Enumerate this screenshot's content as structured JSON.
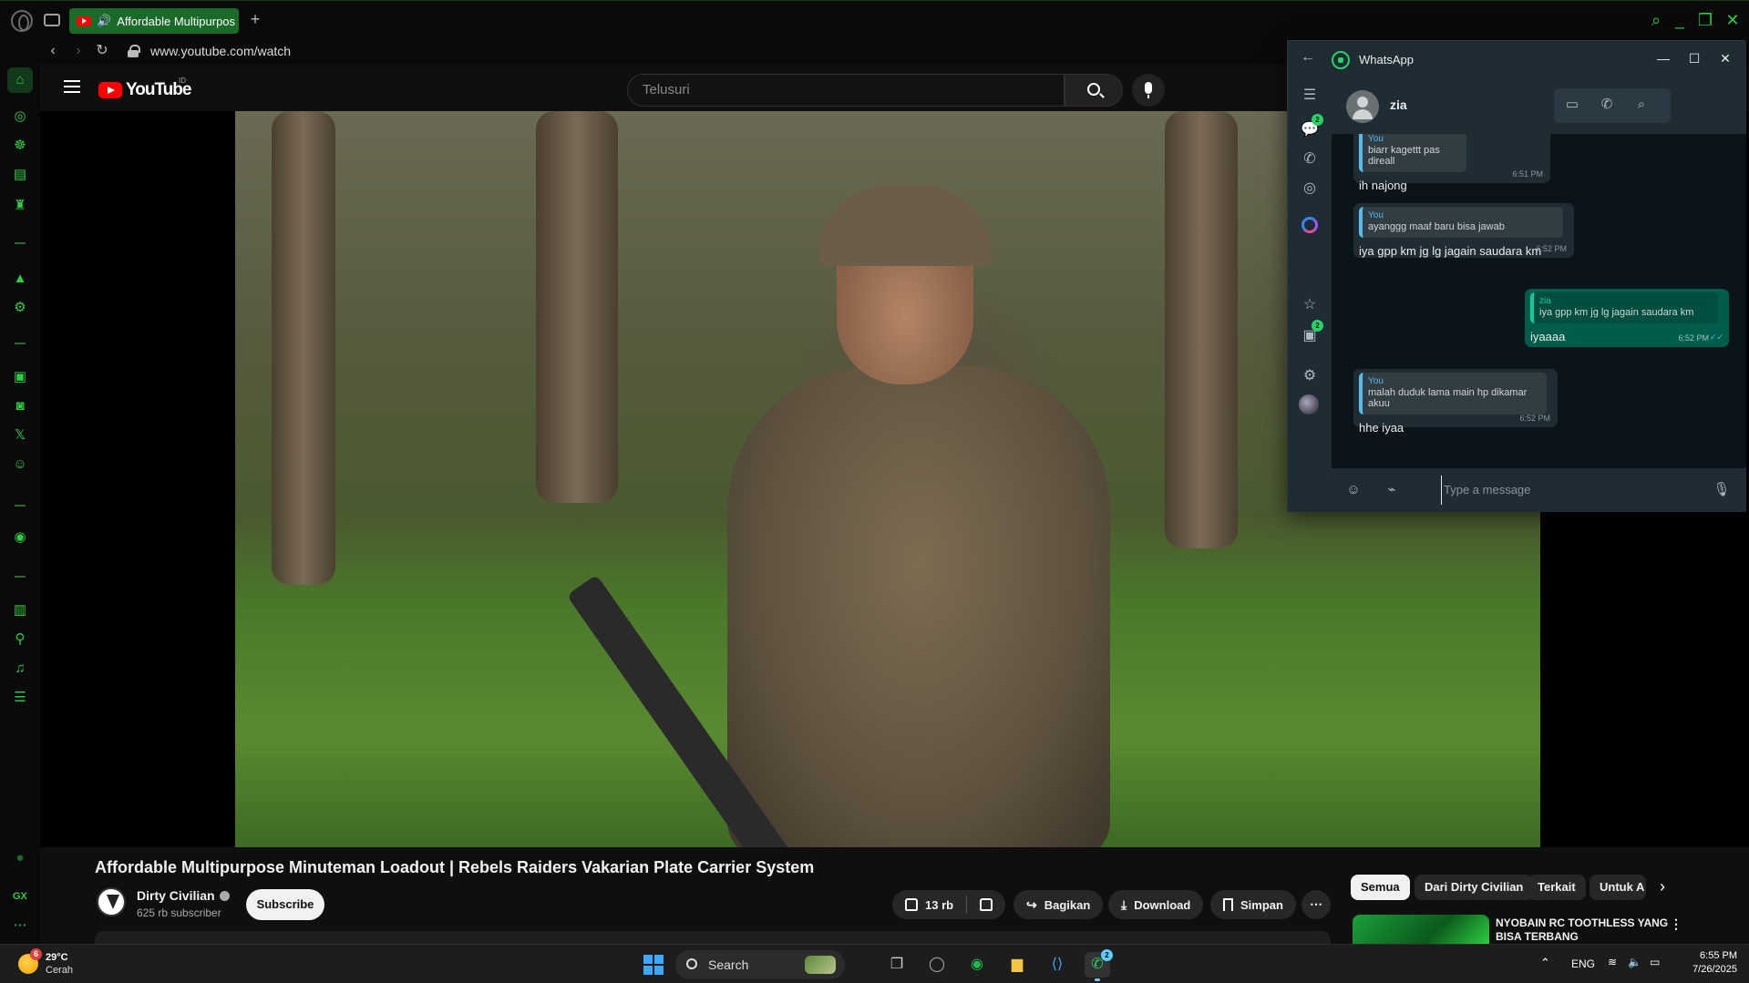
{
  "browser": {
    "tab_title": "Affordable Multipurpos",
    "url": "www.youtube.com/watch",
    "accent": "#2ecc40"
  },
  "youtube": {
    "logo_text": "YouTube",
    "country_code": "ID",
    "search_placeholder": "Telusuri",
    "video_title": "Affordable Multipurpose Minuteman Loadout | Rebels Raiders Vakarian Plate Carrier System",
    "channel_name": "Dirty Civilian",
    "subscribers": "625 rb subscriber",
    "subscribe_label": "Subscribe",
    "like_count": "13 rb",
    "share_label": "Bagikan",
    "download_label": "Download",
    "save_label": "Simpan",
    "chips": [
      "Semua",
      "Dari Dirty Civilian",
      "Terkait",
      "Untuk A"
    ],
    "recommended_title": "NYOBAIN RC TOOTHLESS YANG BISA TERBANG"
  },
  "whatsapp": {
    "window_title": "WhatsApp",
    "contact_name": "zia",
    "chats_badge": "2",
    "archive_badge": "2",
    "compose_placeholder": "Type a message",
    "messages": [
      {
        "direction": "in",
        "quote_author": "You",
        "quote_text": "biarr kagettt pas direall",
        "text": "ih najong",
        "time": "6:51 PM"
      },
      {
        "direction": "in",
        "quote_author": "You",
        "quote_text": "ayanggg maaf baru bisa jawab",
        "text": "iya gpp km jg lg jagain saudara km",
        "time": "6:52 PM"
      },
      {
        "direction": "out",
        "quote_author": "zia",
        "quote_text": "iya gpp km jg lg jagain saudara km",
        "text": "iyaaaa",
        "time": "6:52 PM"
      },
      {
        "direction": "in",
        "quote_author": "You",
        "quote_text": "malah duduk lama main hp dikamar akuu",
        "text": "hhe iyaa",
        "time": "6:52 PM"
      }
    ]
  },
  "taskbar": {
    "weather_badge": "6",
    "temperature": "29°C",
    "condition": "Cerah",
    "search_label": "Search",
    "whatsapp_badge": "2",
    "language": "ENG",
    "time": "6:55 PM",
    "date": "7/26/2025"
  }
}
